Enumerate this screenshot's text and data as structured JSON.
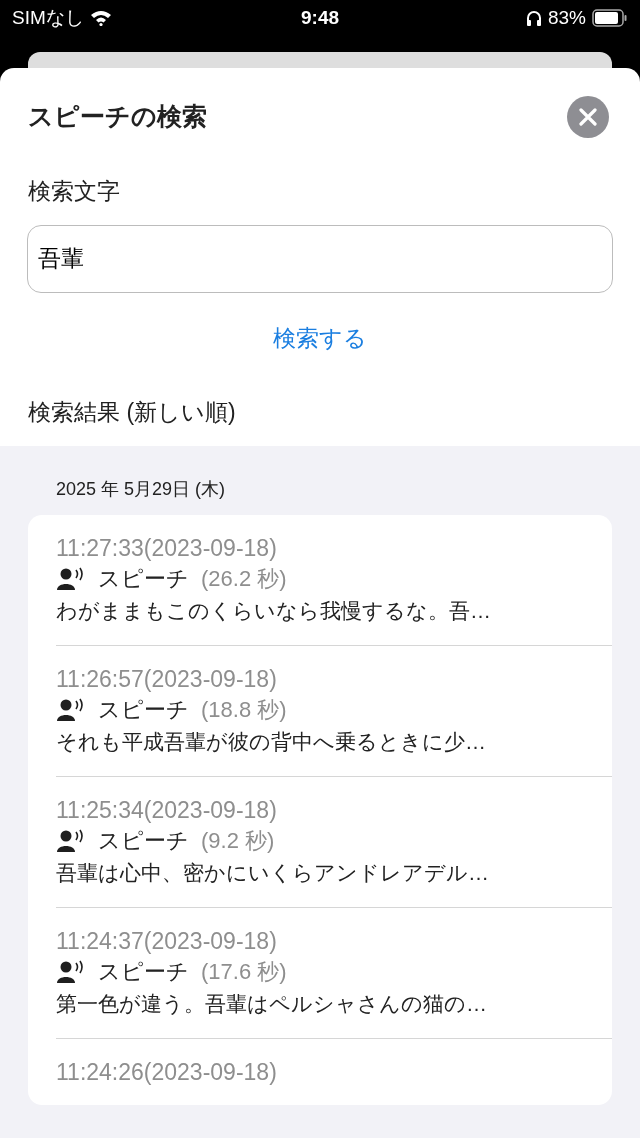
{
  "status_bar": {
    "carrier": "SIMなし",
    "time": "9:48",
    "battery": "83%"
  },
  "sheet": {
    "title": "スピーチの検索",
    "search_label": "検索文字",
    "search_value": "吾輩",
    "search_button": "検索する",
    "results_label": "検索結果 (新しい順)"
  },
  "results": {
    "date": "2025 年 5月29日 (木)",
    "items": [
      {
        "time": "11:27:33(2023-09-18)",
        "type": "スピーチ",
        "duration": "(26.2 秒)",
        "text": "わがままもこのくらいなら我慢するな。吾…"
      },
      {
        "time": "11:26:57(2023-09-18)",
        "type": "スピーチ",
        "duration": "(18.8 秒)",
        "text": "それも平成吾輩が彼の背中へ乗るときに少…"
      },
      {
        "time": "11:25:34(2023-09-18)",
        "type": "スピーチ",
        "duration": "(9.2 秒)",
        "text": "吾輩は心中、密かにいくらアンドレアデル…"
      },
      {
        "time": "11:24:37(2023-09-18)",
        "type": "スピーチ",
        "duration": "(17.6 秒)",
        "text": "第一色が違う。吾輩はペルシャさんの猫の…"
      },
      {
        "time": "11:24:26(2023-09-18)"
      }
    ]
  }
}
